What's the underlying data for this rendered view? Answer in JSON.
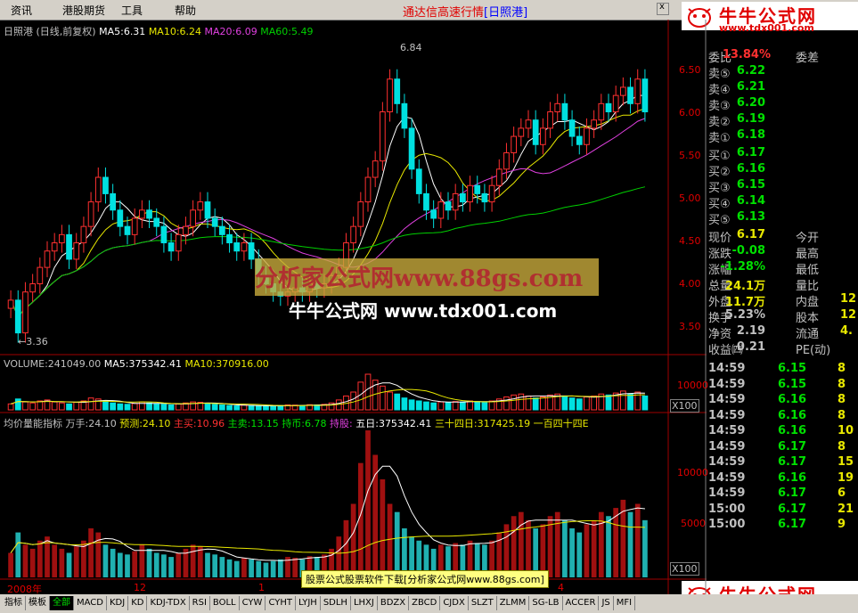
{
  "menu": {
    "items": [
      "资讯",
      "港股期货",
      "工具",
      "帮助"
    ],
    "win_button": "x"
  },
  "app_title": {
    "prefix": "通达信高速行情",
    "stock": "[日照港]"
  },
  "logo": {
    "title": "牛牛公式网",
    "url": "www.tdx001.com"
  },
  "price_panel": {
    "name": "日照港",
    "mode": "(日线,前复权)",
    "ma5": "MA5:6.31",
    "ma10": "MA10:6.24",
    "ma20": "MA20:6.09",
    "ma60": "MA60:5.49",
    "high_label": "6.84",
    "low_label": "←3.36",
    "y_ticks": [
      "6.50",
      "6.00",
      "5.50",
      "5.00",
      "4.50",
      "4.00",
      "3.50"
    ],
    "ylim": [
      3.3,
      7.0
    ]
  },
  "volume_panel": {
    "vol": "VOLUME:241049.00",
    "ma5": "MA5:375342.41",
    "ma10": "MA10:370916.00",
    "tick": "10000",
    "unit": "X100"
  },
  "indicator_panel": {
    "name": "均价量能指标",
    "wanshou": "万手:24.10",
    "yuce": "预测:24.10",
    "zhumai": "主买:10.96",
    "zhumai2": "主卖:13.15",
    "chibi": "持币:6.78",
    "chigu": "持股:",
    "wuri": "五日:375342.41",
    "sansi": "三十四日:317425.19",
    "yibai": "一百四十四E",
    "ticks": [
      "10000",
      "5000"
    ],
    "unit": "X100"
  },
  "x_axis": {
    "labels": [
      "2008年",
      "12",
      "1",
      "4"
    ]
  },
  "watermark": {
    "line1": "分析家公式网www.88gs.com",
    "line2": "牛牛公式网 www.tdx001.com"
  },
  "footer_ad": "股票公式股票软件下载[分析家公式网www.88gs.com]",
  "quote": {
    "weibi_label": "委比",
    "weibi": "13.84%",
    "weicha_label": "委差",
    "sell": [
      {
        "label": "卖⑤",
        "price": "6.22"
      },
      {
        "label": "卖④",
        "price": "6.21"
      },
      {
        "label": "卖③",
        "price": "6.20"
      },
      {
        "label": "卖②",
        "price": "6.19"
      },
      {
        "label": "卖①",
        "price": "6.18"
      }
    ],
    "buy": [
      {
        "label": "买①",
        "price": "6.17"
      },
      {
        "label": "买②",
        "price": "6.16"
      },
      {
        "label": "买③",
        "price": "6.15"
      },
      {
        "label": "买④",
        "price": "6.14"
      },
      {
        "label": "买⑤",
        "price": "6.13"
      }
    ],
    "stats": [
      {
        "l1": "现价",
        "v1": "6.17",
        "l2": "今开",
        "v2": ""
      },
      {
        "l1": "涨跌",
        "v1": "-0.08",
        "l2": "最高",
        "v2": ""
      },
      {
        "l1": "涨幅",
        "v1": "-1.28%",
        "l2": "最低",
        "v2": ""
      },
      {
        "l1": "总量",
        "v1": "24.1万",
        "l2": "量比",
        "v2": ""
      },
      {
        "l1": "外盘",
        "v1": "11.7万",
        "l2": "内盘",
        "v2": "12"
      },
      {
        "l1": "换手",
        "v1": "5.23%",
        "l2": "股本",
        "v2": "12"
      },
      {
        "l1": "净资",
        "v1": "2.19",
        "l2": "流通",
        "v2": "4."
      },
      {
        "l1": "收益㈣",
        "v1": "0.21",
        "l2": "PE(动)",
        "v2": ""
      }
    ],
    "ticks": [
      {
        "time": "14:59",
        "price": "6.15",
        "vol": "8"
      },
      {
        "time": "14:59",
        "price": "6.15",
        "vol": "8"
      },
      {
        "time": "14:59",
        "price": "6.16",
        "vol": "8"
      },
      {
        "time": "14:59",
        "price": "6.16",
        "vol": "8"
      },
      {
        "time": "14:59",
        "price": "6.16",
        "vol": "10"
      },
      {
        "time": "14:59",
        "price": "6.17",
        "vol": "8"
      },
      {
        "time": "14:59",
        "price": "6.17",
        "vol": "15"
      },
      {
        "time": "14:59",
        "price": "6.16",
        "vol": "19"
      },
      {
        "time": "14:59",
        "price": "6.17",
        "vol": "6"
      },
      {
        "time": "15:00",
        "price": "6.17",
        "vol": "21"
      },
      {
        "time": "15:00",
        "price": "6.17",
        "vol": "9"
      }
    ]
  },
  "bottom_tabs": [
    "指标",
    "模板",
    "全部",
    "MACD",
    "KDJ",
    "KD",
    "KDJ-TDX",
    "RSI",
    "BOLL",
    "CYW",
    "CYHT",
    "LYJH",
    "SDLH",
    "LHXJ",
    "BDZX",
    "ZBCD",
    "CJDX",
    "SLZT",
    "ZLMM",
    "SG-LB",
    "ACCER",
    "JS",
    "MFI"
  ],
  "colors": {
    "up": "#ff3030",
    "down": "#00e0e0",
    "ma5": "#ffffff",
    "ma10": "#e8e800",
    "ma20": "#e040e0",
    "ma60": "#00d000"
  },
  "chart_data": {
    "type": "candlestick",
    "ylim": [
      3.3,
      7.0
    ],
    "close": [
      3.9,
      3.5,
      4.0,
      4.1,
      4.3,
      4.5,
      4.6,
      4.7,
      4.4,
      4.6,
      4.8,
      5.1,
      5.4,
      5.2,
      5.0,
      4.8,
      4.7,
      4.9,
      5.0,
      4.9,
      4.8,
      4.6,
      4.5,
      4.7,
      4.8,
      5.0,
      5.1,
      4.9,
      4.8,
      4.7,
      4.6,
      4.5,
      4.6,
      4.4,
      4.2,
      4.1,
      4.0,
      3.95,
      4.0,
      4.05,
      4.0,
      4.1,
      4.05,
      4.1,
      4.2,
      4.3,
      4.6,
      4.8,
      5.1,
      5.4,
      5.6,
      6.2,
      6.6,
      6.3,
      6.0,
      5.5,
      5.2,
      5.0,
      4.9,
      5.1,
      5.0,
      5.2,
      5.1,
      5.3,
      5.2,
      5.1,
      5.3,
      5.5,
      5.7,
      5.9,
      6.0,
      6.1,
      5.8,
      6.0,
      6.2,
      6.3,
      6.1,
      5.9,
      5.8,
      6.0,
      6.1,
      6.3,
      6.2,
      6.4,
      6.5,
      6.3,
      6.6,
      6.2
    ],
    "volume": [
      30,
      55,
      40,
      35,
      45,
      50,
      40,
      35,
      30,
      38,
      45,
      60,
      55,
      40,
      35,
      30,
      28,
      32,
      40,
      35,
      30,
      28,
      25,
      30,
      35,
      40,
      38,
      30,
      28,
      25,
      22,
      20,
      24,
      22,
      20,
      18,
      20,
      22,
      25,
      24,
      22,
      26,
      25,
      28,
      35,
      50,
      70,
      90,
      140,
      180,
      150,
      120,
      90,
      80,
      60,
      50,
      45,
      40,
      35,
      40,
      38,
      42,
      40,
      45,
      42,
      40,
      45,
      55,
      65,
      75,
      80,
      70,
      60,
      65,
      75,
      80,
      70,
      60,
      55,
      65,
      70,
      80,
      75,
      85,
      95,
      80,
      90,
      70
    ]
  }
}
